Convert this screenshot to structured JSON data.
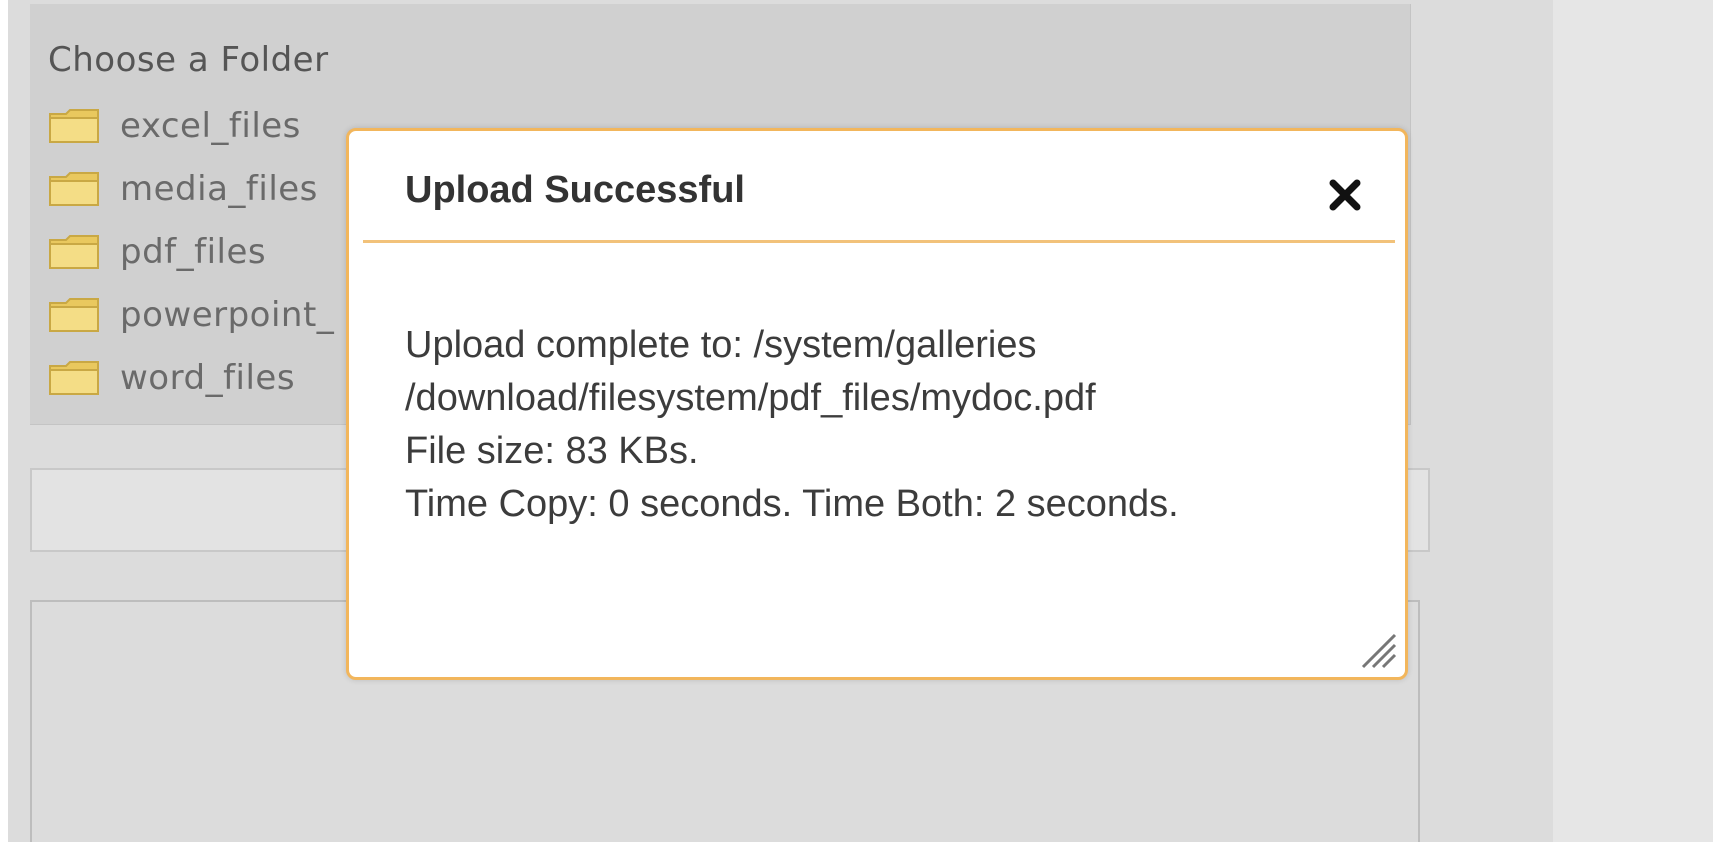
{
  "folder_panel": {
    "title": "Choose a Folder",
    "items": [
      {
        "label": "excel_files",
        "icon": "folder-icon"
      },
      {
        "label": "media_files",
        "icon": "folder-icon"
      },
      {
        "label": "pdf_files",
        "icon": "folder-icon"
      },
      {
        "label": "powerpoint_",
        "icon": "folder-icon"
      },
      {
        "label": "word_files",
        "icon": "folder-icon"
      }
    ]
  },
  "dialog": {
    "title": "Upload Successful",
    "close_icon": "close-icon",
    "lines": [
      "Upload complete to: /system/galleries",
      "/download/filesystem/pdf_files/mydoc.pdf",
      "File size: 83 KBs.",
      "Time Copy: 0 seconds. Time Both: 2 seconds."
    ],
    "resize_icon": "resize-handle-icon"
  },
  "colors": {
    "dialog_border": "#f2b65c",
    "folder_fill": "#f2d678",
    "background": "#dcdcdc"
  }
}
